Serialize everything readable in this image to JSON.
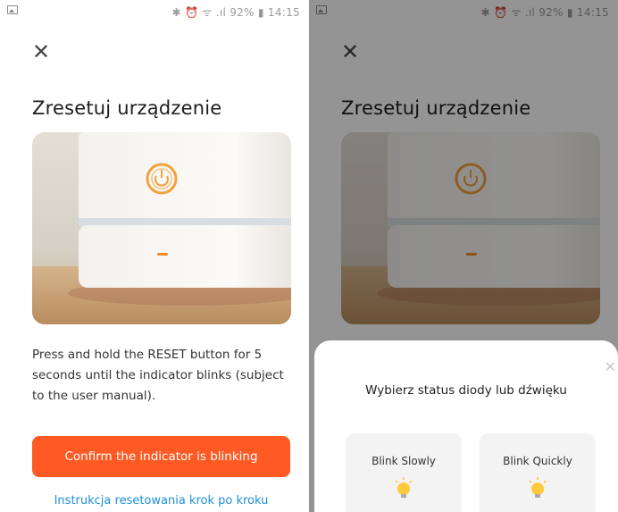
{
  "left_screen": {
    "status_bar": {
      "right_text": "✱ ⏰ ᯤ .ıl 92% ▮ 14:15"
    },
    "close_symbol": "✕",
    "title": "Zresetuj urządzenie",
    "instruction": "Press and hold the RESET button for 5 seconds until the indicator blinks (subject to the user manual).",
    "confirm_button": "Confirm the indicator is blinking",
    "guide_link": "Instrukcja resetowania krok po kroku"
  },
  "right_screen": {
    "status_bar": {
      "right_text": "✱ ⏰ ᯤ .ıl 92% ▮ 14:15"
    },
    "close_symbol": "✕",
    "title": "Zresetuj urządzenie",
    "sheet": {
      "close_symbol": "✕",
      "title": "Wybierz status diody lub dźwięku",
      "options": [
        {
          "label": "Blink Slowly",
          "icon": "lightbulb-icon"
        },
        {
          "label": "Blink Quickly",
          "icon": "lightbulb-icon"
        }
      ]
    }
  },
  "colors": {
    "accent": "#ff5a24",
    "link": "#1f8fd6",
    "indicator_ring": "#f2a13c",
    "bulb": "#ffc93c"
  }
}
